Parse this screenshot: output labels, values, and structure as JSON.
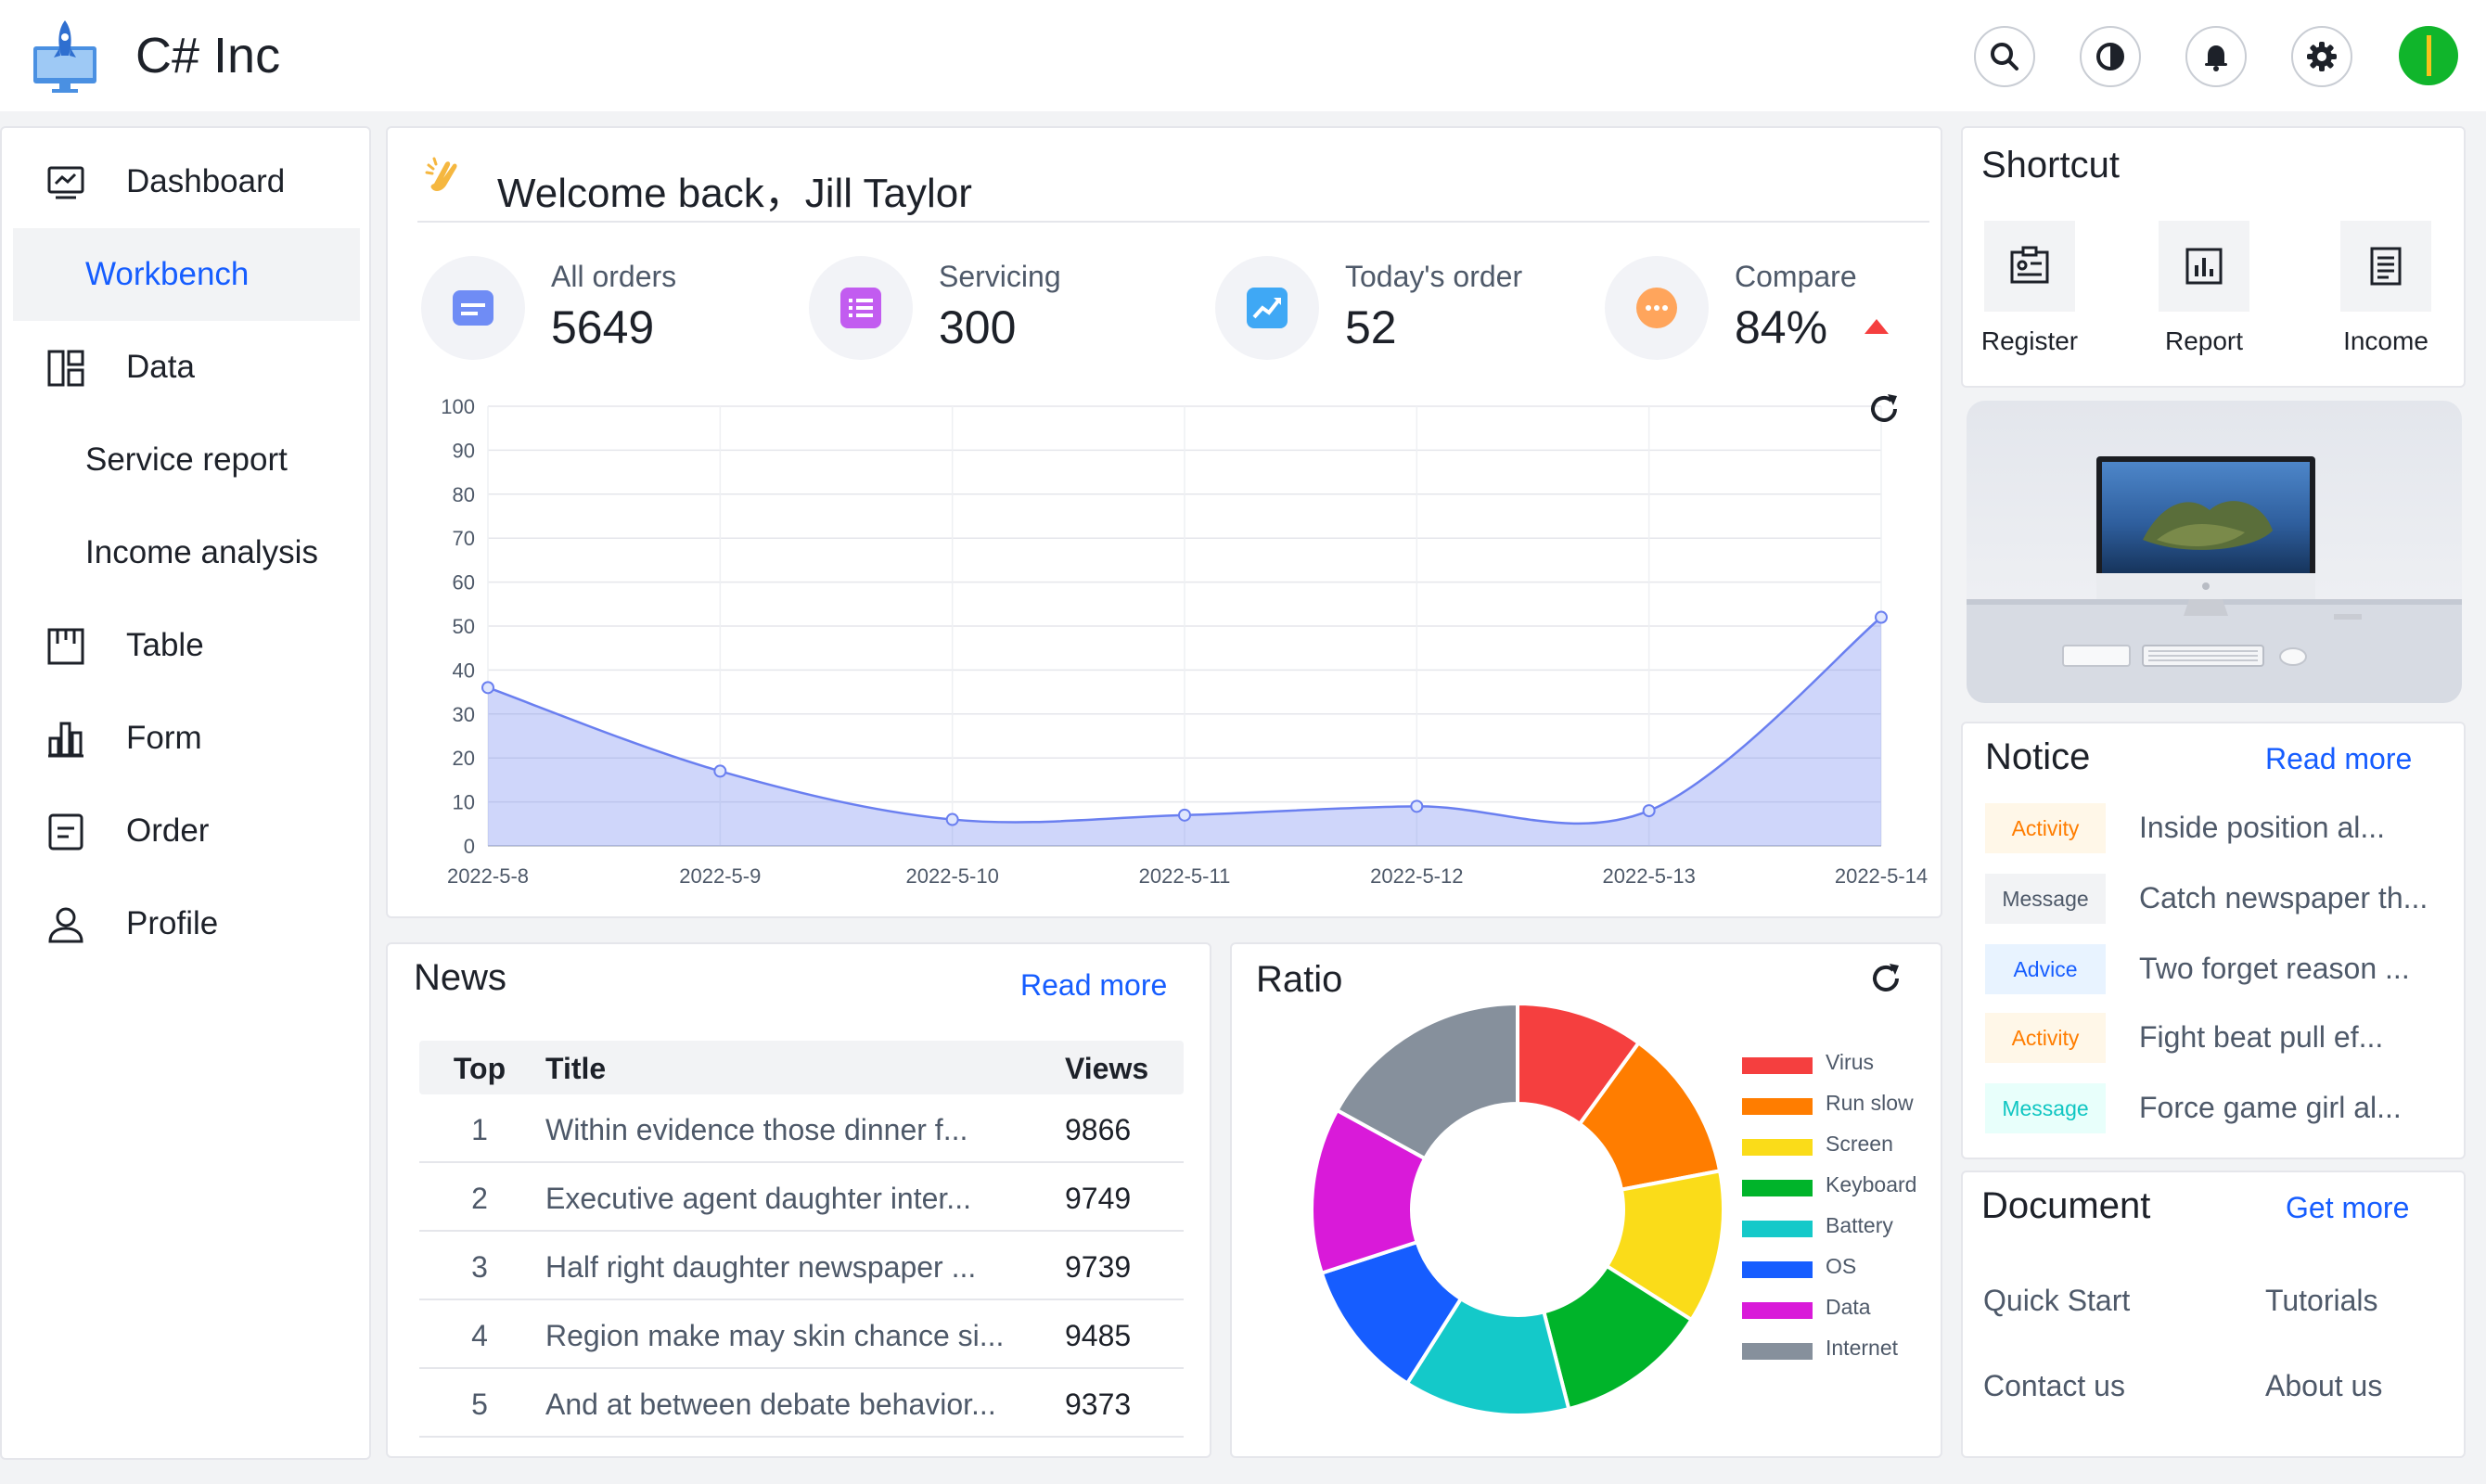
{
  "header": {
    "app_name": "C# Inc",
    "icons": [
      "search-icon",
      "theme-contrast-icon",
      "bell-icon",
      "gear-icon",
      "avatar"
    ]
  },
  "sidebar": {
    "items": [
      {
        "label": "Dashboard",
        "icon": "dashboard-icon"
      },
      {
        "label": "Workbench",
        "active": true
      },
      {
        "label": "Data",
        "icon": "data-layout-icon"
      },
      {
        "label": "Service report"
      },
      {
        "label": "Income analysis"
      },
      {
        "label": "Table",
        "icon": "table-icon"
      },
      {
        "label": "Form",
        "icon": "form-icon"
      },
      {
        "label": "Order",
        "icon": "order-icon"
      },
      {
        "label": "Profile",
        "icon": "profile-icon"
      }
    ]
  },
  "welcome": {
    "greeting": "Welcome back，Jill Taylor",
    "stats": [
      {
        "label": "All orders",
        "value": "5649",
        "color": "#6f8cf5"
      },
      {
        "label": "Servicing",
        "value": "300",
        "color": "#c25cf0"
      },
      {
        "label": "Today's order",
        "value": "52",
        "color": "#3fa8f5"
      },
      {
        "label": "Compare",
        "value": "84%",
        "color": "#ffa55c",
        "trend": "up"
      }
    ]
  },
  "chart_data": [
    {
      "type": "area",
      "x": [
        "2022-5-8",
        "2022-5-9",
        "2022-5-10",
        "2022-5-11",
        "2022-5-12",
        "2022-5-13",
        "2022-5-14"
      ],
      "series": [
        {
          "values": [
            36,
            17,
            6,
            7,
            9,
            8,
            52
          ],
          "color": "#6a7ff0"
        }
      ],
      "y_ticks": [
        "0",
        "10",
        "20",
        "30",
        "40",
        "50",
        "60",
        "70",
        "80",
        "90",
        "100"
      ],
      "ylim": [
        0,
        100
      ],
      "grid": true
    },
    {
      "type": "pie",
      "title": "Ratio",
      "categories": [
        "Virus",
        "Run slow",
        "Screen",
        "Keyboard",
        "Battery",
        "OS",
        "Data",
        "Internet"
      ],
      "values": [
        10,
        12,
        12,
        12,
        13,
        11,
        13,
        17
      ],
      "colors": [
        "#f53f3f",
        "#ff7d00",
        "#fadc19",
        "#00b42a",
        "#14c9c9",
        "#165dff",
        "#d91ad9",
        "#86909c"
      ],
      "legend": "right"
    }
  ],
  "shortcut": {
    "title": "Shortcut",
    "items": [
      {
        "label": "Register",
        "icon": "register-icon"
      },
      {
        "label": "Report",
        "icon": "report-chart-icon"
      },
      {
        "label": "Income",
        "icon": "income-document-icon"
      }
    ]
  },
  "notice": {
    "title": "Notice",
    "read_more": "Read more",
    "items": [
      {
        "tag": "Activity",
        "text": "Inside position al..."
      },
      {
        "tag": "Message",
        "text": "Catch newspaper th..."
      },
      {
        "tag": "Advice",
        "text": "Two forget reason ..."
      },
      {
        "tag": "Activity",
        "text": "Fight beat pull ef..."
      },
      {
        "tag": "Message",
        "text": "Force game girl al..."
      }
    ]
  },
  "document": {
    "title": "Document",
    "get_more": "Get more",
    "links": [
      "Quick Start",
      "Tutorials",
      "Contact us",
      "About us"
    ]
  },
  "news": {
    "title": "News",
    "read_more": "Read more",
    "columns": [
      "Top",
      "Title",
      "Views"
    ],
    "rows": [
      {
        "top": "1",
        "title": "Within evidence those dinner f...",
        "views": "9866"
      },
      {
        "top": "2",
        "title": "Executive agent daughter inter...",
        "views": "9749"
      },
      {
        "top": "3",
        "title": "Half right daughter newspaper ...",
        "views": "9739"
      },
      {
        "top": "4",
        "title": "Region make may skin chance si...",
        "views": "9485"
      },
      {
        "top": "5",
        "title": "And at between debate behavior...",
        "views": "9373"
      }
    ]
  }
}
